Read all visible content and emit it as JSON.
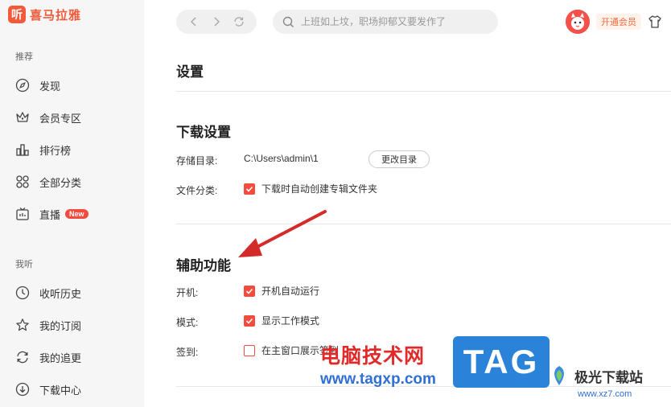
{
  "app": {
    "logo_glyph": "听",
    "name": "喜马拉雅",
    "brand_color": "#f35a3a"
  },
  "sidebar": {
    "section1": "推荐",
    "items1": [
      {
        "label": "发现",
        "icon": "compass-icon"
      },
      {
        "label": "会员专区",
        "icon": "crown-icon"
      },
      {
        "label": "排行榜",
        "icon": "ranking-icon"
      },
      {
        "label": "全部分类",
        "icon": "grid-icon"
      },
      {
        "label": "直播",
        "icon": "live-tv-icon",
        "badge": "New"
      }
    ],
    "section2": "我听",
    "items2": [
      {
        "label": "收听历史",
        "icon": "clock-icon"
      },
      {
        "label": "我的订阅",
        "icon": "star-icon"
      },
      {
        "label": "我的追更",
        "icon": "refresh-icon"
      },
      {
        "label": "下载中心",
        "icon": "download-icon"
      }
    ]
  },
  "topbar": {
    "search_placeholder": "上班如上坟，职场抑郁又要发作了",
    "vip_label": "开通会员"
  },
  "settings": {
    "title": "设置",
    "download": {
      "title": "下载设置",
      "storage_label": "存储目录:",
      "storage_path": "C:\\Users\\admin\\1",
      "change_button": "更改目录",
      "category_label": "文件分类:",
      "category_option": "下载时自动创建专辑文件夹",
      "category_checked": true
    },
    "accessibility": {
      "title": "辅助功能",
      "startup_label": "开机:",
      "startup_option": "开机自动运行",
      "startup_checked": true,
      "mode_label": "模式:",
      "mode_option": "显示工作模式",
      "mode_checked": true,
      "signin_label": "签到:",
      "signin_option": "在主窗口展示签到",
      "signin_checked": false
    }
  },
  "watermark": {
    "site_name": "电脑技术网",
    "site_url": "www.tagxp.com",
    "tag": "TAG",
    "jg_name": "极光下载站",
    "jg_url": "www.xz7.com"
  }
}
